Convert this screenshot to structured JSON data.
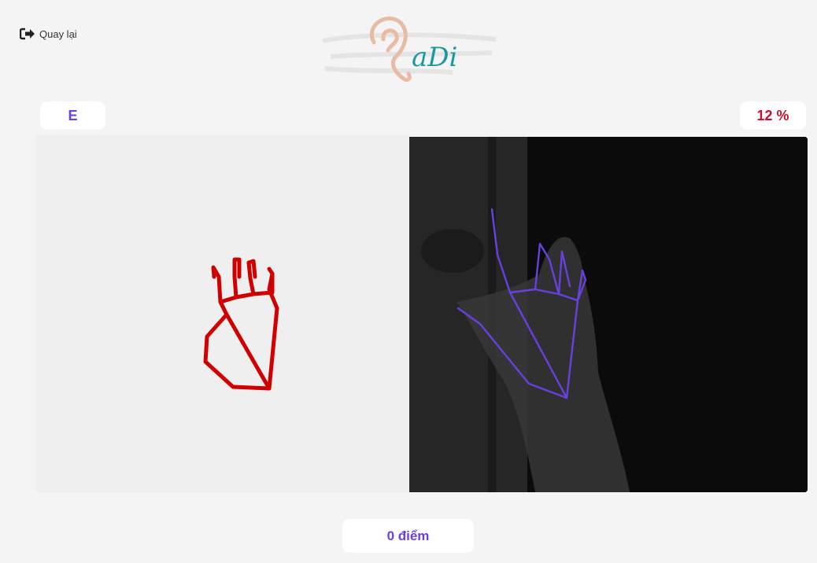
{
  "header": {
    "back_label": "Quay lại",
    "back_icon": "sign-out-arrow-icon",
    "logo_text": "aDi",
    "logo_icon": "ear-icon"
  },
  "lesson": {
    "letter": "E",
    "match_percent": "12 %"
  },
  "score": {
    "label": "0 điểm"
  },
  "colors": {
    "accent_purple": "#6a3fe0",
    "percent_red": "#c8102e",
    "reference_skeleton": "#d10000",
    "detected_skeleton": "#6a3fe0",
    "logo_ear": "#e8bba3",
    "logo_text": "#1a9aa0"
  }
}
